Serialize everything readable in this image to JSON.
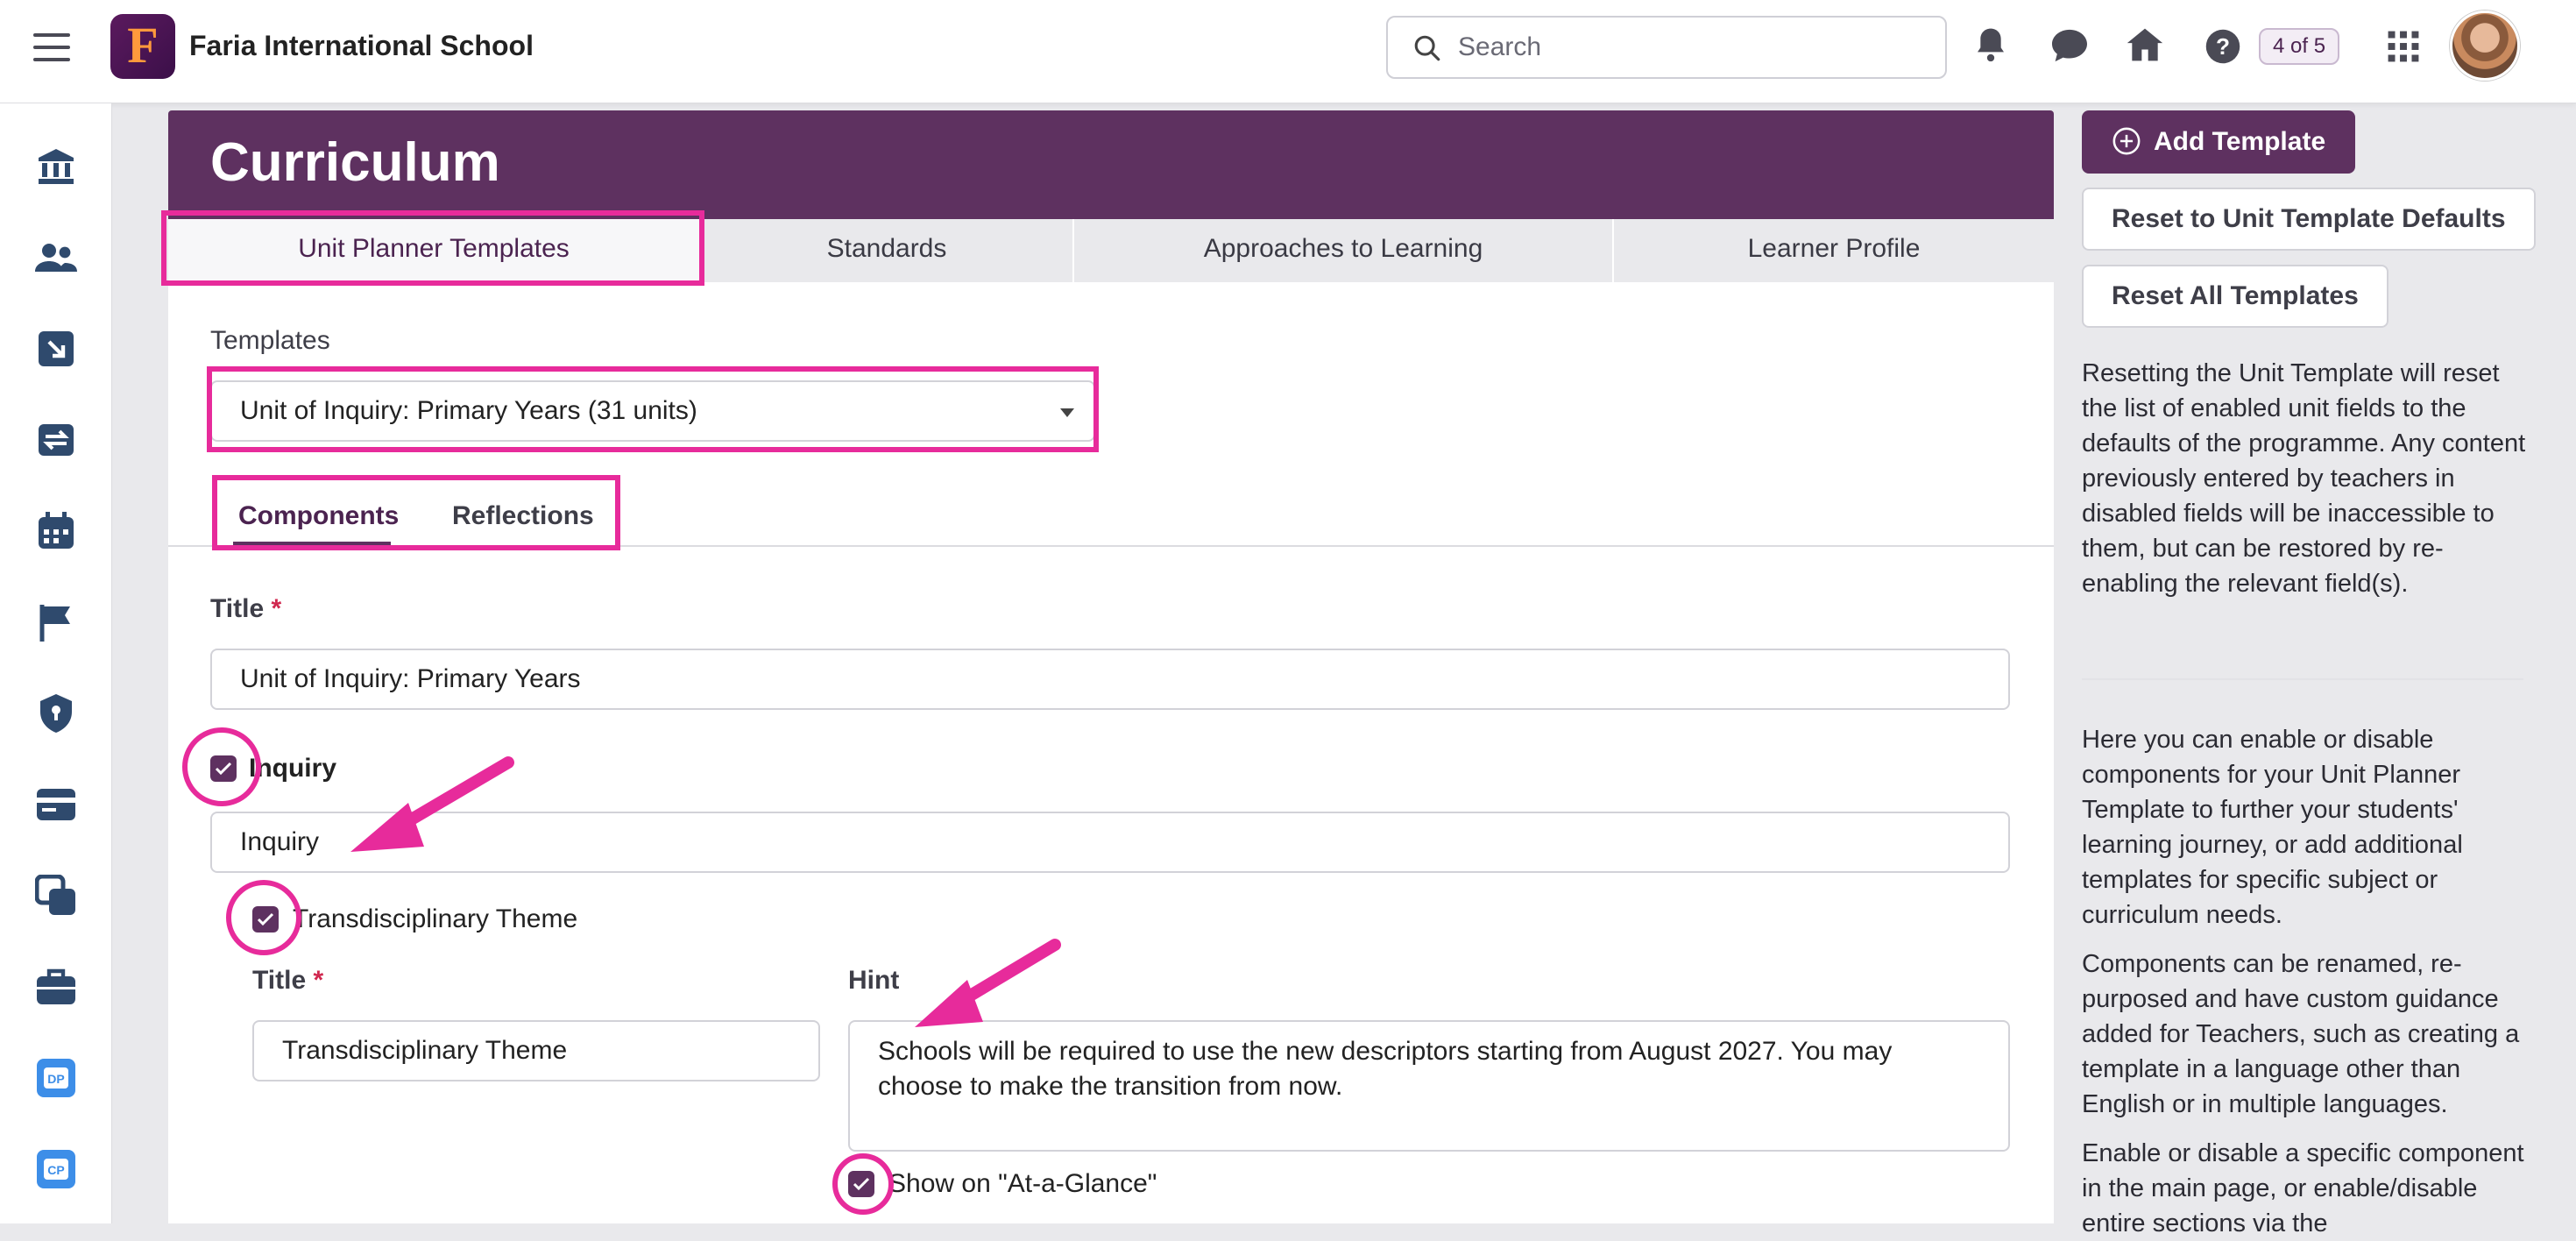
{
  "topbar": {
    "school_name": "Faria International School",
    "logo_letter": "F",
    "search_placeholder": "Search",
    "progress_badge": "4 of 5",
    "icons": [
      "menu-icon",
      "bell-icon",
      "chat-icon",
      "home-icon",
      "help-icon",
      "apps-grid-icon"
    ]
  },
  "sidebar": {
    "icons": [
      "institution-icon",
      "people-icon",
      "import-icon",
      "sync-icon",
      "calendar-icon",
      "flag-icon",
      "shield-icon",
      "card-icon",
      "layers-icon",
      "briefcase-icon",
      "dp-icon",
      "cp-icon"
    ],
    "dp_label": "DP",
    "cp_label": "CP"
  },
  "page": {
    "title": "Curriculum",
    "tabs": [
      {
        "label": "Unit Planner Templates",
        "active": true
      },
      {
        "label": "Standards",
        "active": false
      },
      {
        "label": "Approaches to Learning",
        "active": false
      },
      {
        "label": "Learner Profile",
        "active": false
      }
    ]
  },
  "form": {
    "templates_label": "Templates",
    "template_selected": "Unit of Inquiry: Primary Years (31 units)",
    "subtabs": [
      {
        "label": "Components",
        "active": true
      },
      {
        "label": "Reflections",
        "active": false
      }
    ],
    "title_label": "Title",
    "required_mark": "*",
    "title_value": "Unit of Inquiry: Primary Years",
    "inquiry_checkbox_label": "Inquiry",
    "inquiry_value": "Inquiry",
    "theme_checkbox_label": "Transdisciplinary Theme",
    "theme_title_label": "Title",
    "theme_title_value": "Transdisciplinary Theme",
    "hint_label": "Hint",
    "hint_value": "Schools will be required to use the new descriptors starting from August 2027. You may choose to make the transition from now.",
    "glance_checkbox_label": "Show on \"At-a-Glance\""
  },
  "right_panel": {
    "add_template": "Add Template",
    "reset_unit_defaults": "Reset to Unit Template Defaults",
    "reset_all": "Reset All Templates",
    "reset_info": "Resetting the Unit Template will reset the list of enabled unit fields to the defaults of the programme. Any content previously entered by teachers in disabled fields will be inaccessible to them, but can be restored by re-enabling the relevant field(s).",
    "help_1": "Here you can enable or disable components for your Unit Planner Template to further your students' learning journey, or add additional templates for specific subject or curriculum needs.",
    "help_2": "Components can be renamed, re-purposed and have custom guidance added for Teachers, such as creating a template in a language other than English or in multiple languages.",
    "help_3": "Enable or disable a specific component in the main page, or enable/disable entire sections via the"
  },
  "colors": {
    "brand_purple": "#5e3160",
    "highlight_pink": "#e72b9b",
    "required_red": "#d0284f"
  }
}
